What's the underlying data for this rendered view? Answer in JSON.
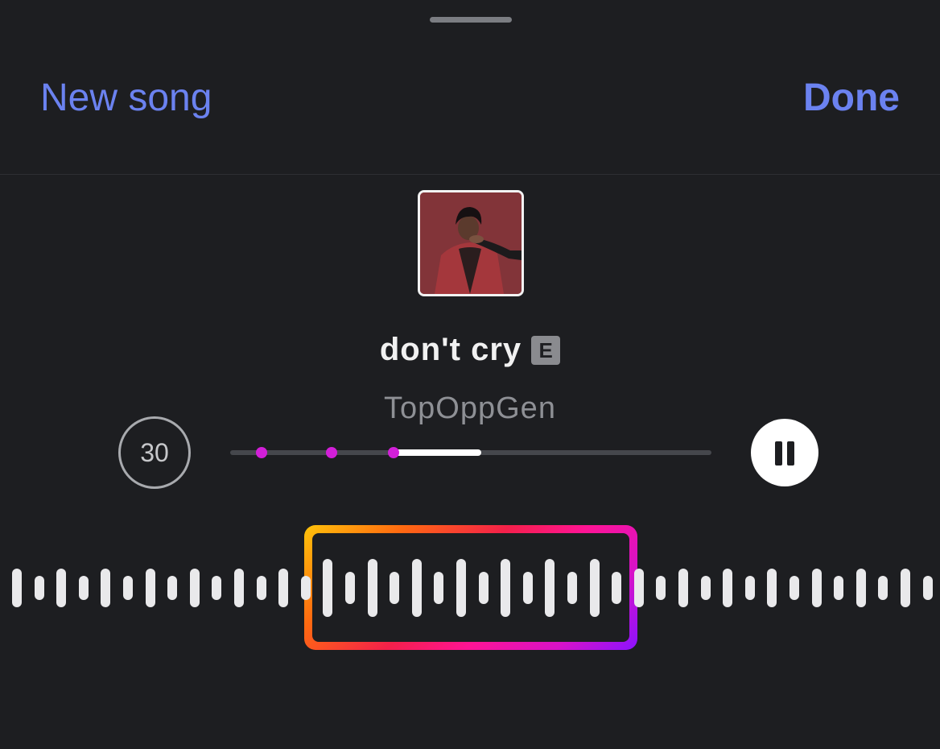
{
  "header": {
    "left_button": "New song",
    "right_button": "Done"
  },
  "track": {
    "title": "don't cry",
    "explicit_badge": "E",
    "artist": "TopOppGen",
    "cover_art": "album-cover-man-red-background"
  },
  "controls": {
    "duration": "30",
    "progress_fraction": 0.35,
    "play_state": "playing",
    "pause_icon": "pause-icon"
  },
  "colors": {
    "accent": "#6b82f0",
    "marker": "#d21fd8",
    "selector_gradient": [
      "#ffc40a",
      "#ff6a10",
      "#f4204a",
      "#ff1493",
      "#d712c8",
      "#8a12ff"
    ]
  }
}
